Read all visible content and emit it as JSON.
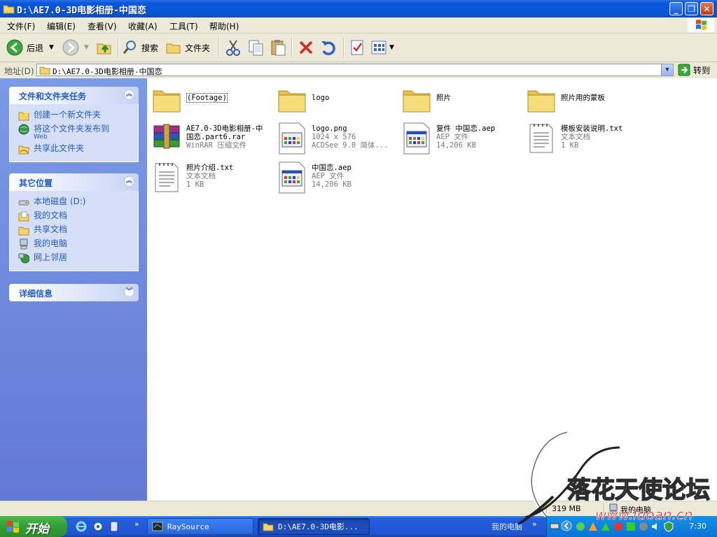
{
  "window": {
    "title": "D:\\AE7.0-3D电影相册-中国恋"
  },
  "menu": [
    {
      "label": "文件(F)"
    },
    {
      "label": "编辑(E)"
    },
    {
      "label": "查看(V)"
    },
    {
      "label": "收藏(A)"
    },
    {
      "label": "工具(T)"
    },
    {
      "label": "帮助(H)"
    }
  ],
  "toolbar": {
    "back_label": "后退",
    "search_label": "搜索",
    "folders_label": "文件夹"
  },
  "address": {
    "label": "地址(D)",
    "value": "D:\\AE7.0-3D电影相册-中国恋",
    "go_label": "转到"
  },
  "tasks_panel": {
    "title": "文件和文件夹任务",
    "links": [
      {
        "label": "创建一个新文件夹"
      },
      {
        "label": "将这个文件夹发布到",
        "sub": "Web"
      },
      {
        "label": "共享此文件夹"
      }
    ]
  },
  "places_panel": {
    "title": "其它位置",
    "links": [
      {
        "label": "本地磁盘 (D:)"
      },
      {
        "label": "我的文档"
      },
      {
        "label": "共享文档"
      },
      {
        "label": "我的电脑"
      },
      {
        "label": "网上邻居"
      }
    ]
  },
  "details_panel": {
    "title": "详细信息"
  },
  "files": [
    {
      "name": "(Footage)",
      "type": "folder"
    },
    {
      "name": "logo",
      "type": "folder"
    },
    {
      "name": "照片",
      "type": "folder"
    },
    {
      "name": "照片用的蒙板",
      "type": "folder"
    },
    {
      "name": "AE7.0-3D电影相册-中",
      "name2": "国恋.part6.rar",
      "desc": "WinRAR 压缩文件",
      "type": "rar"
    },
    {
      "name": "logo.png",
      "desc": "1024 x 576",
      "desc2": "ACDSee 9.0 简体...",
      "type": "img"
    },
    {
      "name": "复件 中国恋.aep",
      "desc": "AEP 文件",
      "desc2": "14,206 KB",
      "type": "app"
    },
    {
      "name": "模板安装说明.txt",
      "desc": "文本文档",
      "desc2": "1 KB",
      "type": "txt"
    },
    {
      "name": "照片介绍.txt",
      "desc": "文本文档",
      "desc2": "1 KB",
      "type": "txt"
    },
    {
      "name": "中国恋.aep",
      "desc": "AEP 文件",
      "desc2": "14,206 KB",
      "type": "app"
    }
  ],
  "status": {
    "size": "319 MB",
    "location": "我的电脑"
  },
  "taskbar": {
    "start_label": "开始",
    "tasks": [
      {
        "label": "RaySource"
      },
      {
        "label": "D:\\AE7.0-3D电影..."
      }
    ],
    "tray_label": "我的电脑",
    "clock": "7:30"
  },
  "watermark": {
    "text": "落花天使论坛",
    "url": "www.luoan.cn"
  }
}
